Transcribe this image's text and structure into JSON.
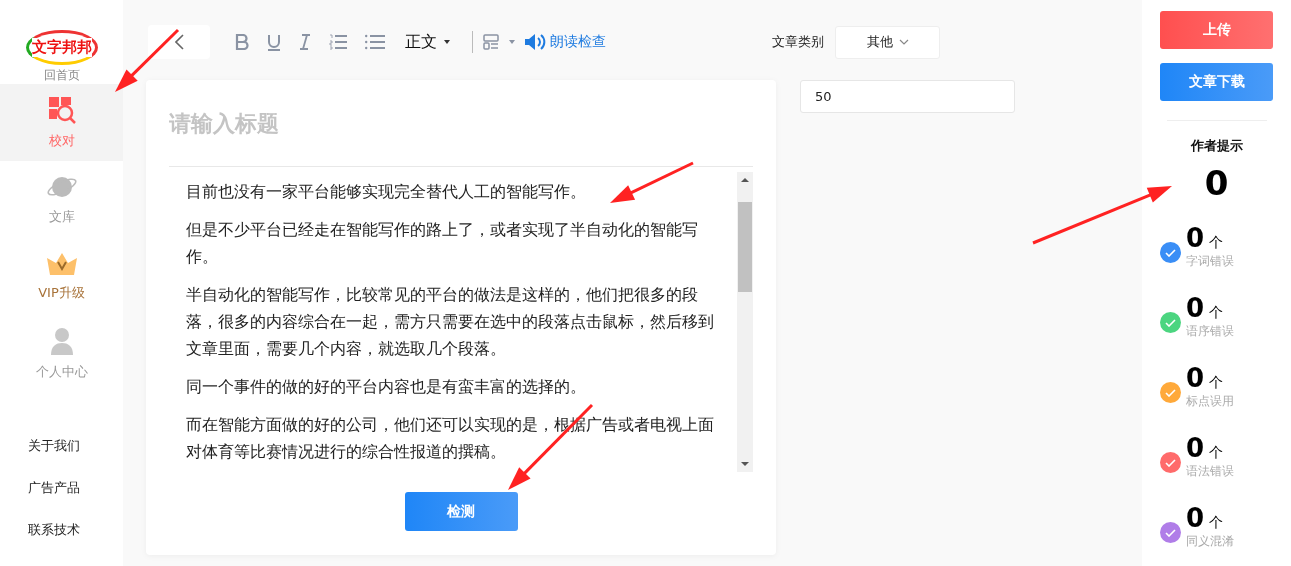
{
  "logo": {
    "text": "文字邦邦",
    "caption": "回首页"
  },
  "sidebar": {
    "items": [
      {
        "label": "校对",
        "kind": "proofread",
        "selected": true
      },
      {
        "label": "文库",
        "kind": "library",
        "selected": false
      },
      {
        "label": "VIP升级",
        "kind": "vip",
        "selected": false
      },
      {
        "label": "个人中心",
        "kind": "user",
        "selected": false
      }
    ],
    "links": [
      "关于我们",
      "广告产品",
      "联系技术"
    ]
  },
  "toolbar": {
    "style_select": "正文",
    "read_check": "朗读检查"
  },
  "category": {
    "label": "文章类别",
    "value": "其他"
  },
  "count_field": {
    "value": "50"
  },
  "editor": {
    "title_placeholder": "请输入标题",
    "paragraphs": [
      "目前也没有一家平台能够实现完全替代人工的智能写作。",
      "但是不少平台已经走在智能写作的路上了，或者实现了半自动化的智能写作。",
      "半自动化的智能写作，比较常见的平台的做法是这样的，他们把很多的段落，很多的内容综合在一起，需方只需要在选中的段落点击鼠标，然后移到文章里面，需要几个内容，就选取几个段落。",
      "同一个事件的做的好的平台内容也是有蛮丰富的选择的。",
      "而在智能方面做的好的公司，他们还可以实现的是，根据广告或者电视上面对体育等比赛情况进行的综合性报道的撰稿。"
    ],
    "check_button": "检测"
  },
  "actions": {
    "upload": "上传",
    "download": "文章下载"
  },
  "tips": {
    "title": "作者提示",
    "total": "0",
    "stats": [
      {
        "count": "0",
        "unit": "个",
        "label": "字词错误",
        "color": "#3a8ef6"
      },
      {
        "count": "0",
        "unit": "个",
        "label": "语序错误",
        "color": "#4cd580"
      },
      {
        "count": "0",
        "unit": "个",
        "label": "标点误用",
        "color": "#ffa93a"
      },
      {
        "count": "0",
        "unit": "个",
        "label": "语法错误",
        "color": "#ff6b6b"
      },
      {
        "count": "0",
        "unit": "个",
        "label": "同义混淆",
        "color": "#b07de8"
      }
    ]
  },
  "annotations": [
    {
      "kind": "arrow"
    },
    {
      "kind": "arrow"
    },
    {
      "kind": "arrow"
    },
    {
      "kind": "arrow"
    }
  ]
}
